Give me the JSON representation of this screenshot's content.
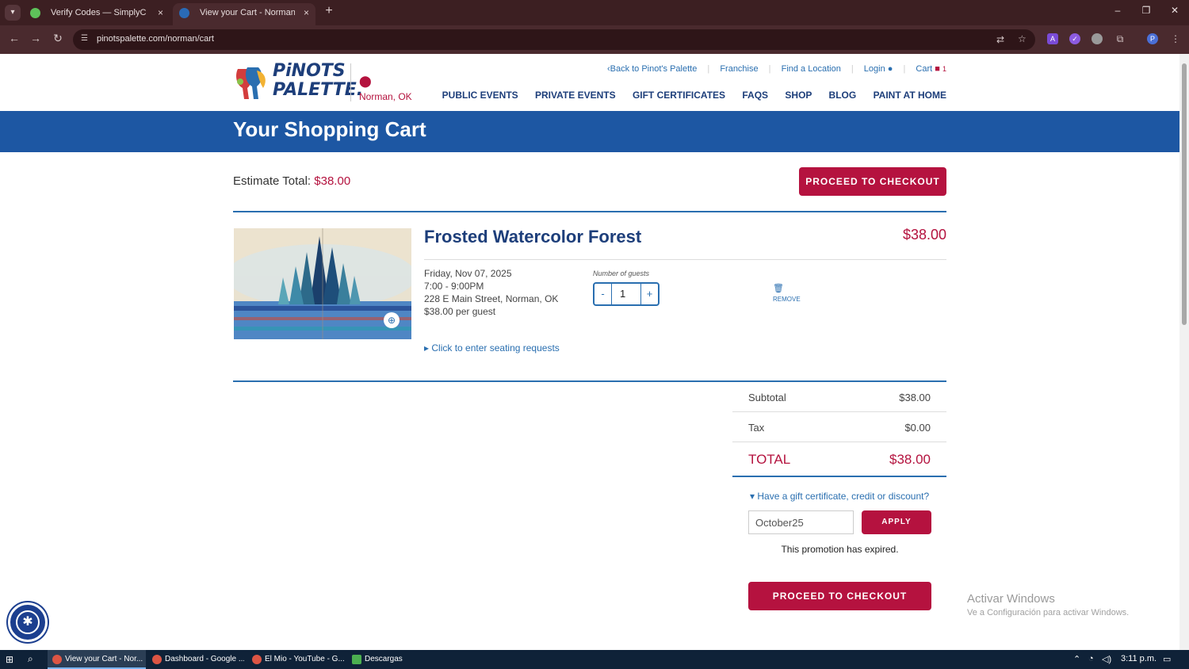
{
  "browser": {
    "tabs": [
      {
        "title": "Verify Codes — SimplyCodes",
        "close": "×"
      },
      {
        "title": "View your Cart - Norman Pinot",
        "close": "×"
      }
    ],
    "new_tab": "+",
    "url": "pinotspalette.com/norman/cart",
    "window_controls": {
      "minimize": "–",
      "restore": "❐",
      "close": "✕"
    }
  },
  "site": {
    "logo_text_line1": "PiNOTS",
    "logo_text_line2": "PALETTE.",
    "location": "Norman, OK",
    "top_links": {
      "back": "Back to Pinot's Palette",
      "franchise": "Franchise",
      "find": "Find a Location",
      "login": "Login",
      "cart": "Cart",
      "cart_count": "1"
    },
    "nav": [
      "PUBLIC EVENTS",
      "PRIVATE EVENTS",
      "GIFT CERTIFICATES",
      "FAQS",
      "SHOP",
      "BLOG",
      "PAINT AT HOME"
    ]
  },
  "cart": {
    "page_title": "Your Shopping Cart",
    "estimate_label": "Estimate Total:",
    "estimate_value": "$38.00",
    "checkout_label": "PROCEED TO CHECKOUT",
    "item": {
      "title": "Frosted Watercolor Forest",
      "price": "$38.00",
      "date": "Friday, Nov 07, 2025",
      "time": "7:00 - 9:00PM",
      "address": "228 E Main Street, Norman, OK",
      "per_guest": "$38.00 per guest",
      "guests_label": "Number of guests",
      "guests_value": "1",
      "minus": "-",
      "plus": "+",
      "remove": "REMOVE",
      "seating": "Click to enter seating requests"
    },
    "summary": {
      "subtotal_label": "Subtotal",
      "subtotal_value": "$38.00",
      "tax_label": "Tax",
      "tax_value": "$0.00",
      "total_label": "TOTAL",
      "total_value": "$38.00"
    },
    "promo": {
      "toggle": "Have a gift certificate, credit or discount?",
      "code": "October25",
      "apply": "APPLY",
      "message": "This promotion has expired."
    }
  },
  "watermark": {
    "line1": "Activar Windows",
    "line2": "Ve a Configuración para activar Windows."
  },
  "taskbar": {
    "items": [
      "View your Cart - Nor...",
      "Dashboard - Google ...",
      "El Mio - YouTube - G...",
      "Descargas"
    ],
    "time": "3:11 p.m."
  },
  "colors": {
    "brand_blue": "#1d57a3",
    "navy": "#1d3e7a",
    "crimson": "#b5123f",
    "link_blue": "#2a6fb0"
  }
}
